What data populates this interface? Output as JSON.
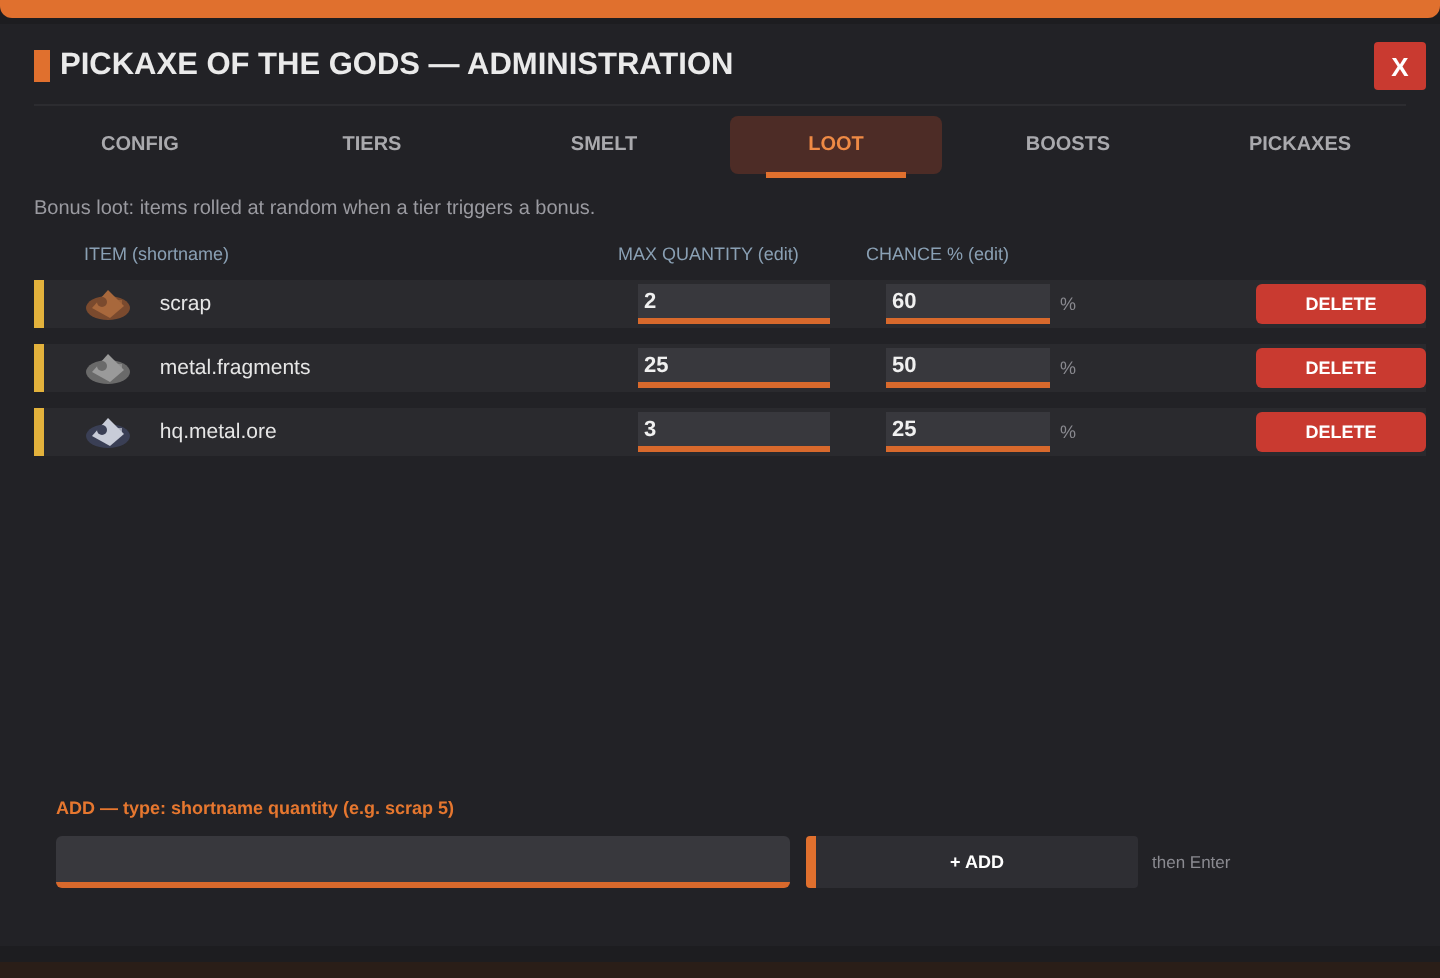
{
  "window": {
    "title": "PICKAXE OF THE GODS — ADMINISTRATION",
    "close": "X"
  },
  "tabs": [
    {
      "label": "CONFIG",
      "selected": false
    },
    {
      "label": "TIERS",
      "selected": false
    },
    {
      "label": "SMELT",
      "selected": false
    },
    {
      "label": "LOOT",
      "selected": true
    },
    {
      "label": "BOOSTS",
      "selected": false
    },
    {
      "label": "PICKAXES",
      "selected": false
    }
  ],
  "intro": "Bonus loot: items rolled at random when a tier triggers a bonus.",
  "table": {
    "columns": [
      "ITEM (shortname)",
      "MAX QUANTITY (edit)",
      "CHANCE % (edit)"
    ],
    "rows": [
      {
        "item": "scrap",
        "max_quantity": "2",
        "chance": "60",
        "unit": "%",
        "action": "DELETE"
      },
      {
        "item": "metal.fragments",
        "max_quantity": "25",
        "chance": "50",
        "unit": "%",
        "action": "DELETE"
      },
      {
        "item": "hq.metal.ore",
        "max_quantity": "3",
        "chance": "25",
        "unit": "%",
        "action": "DELETE"
      }
    ]
  },
  "add": {
    "label": "ADD — type: shortname quantity (e.g. scrap 5)",
    "button": "+  ADD",
    "hint": "then Enter"
  }
}
